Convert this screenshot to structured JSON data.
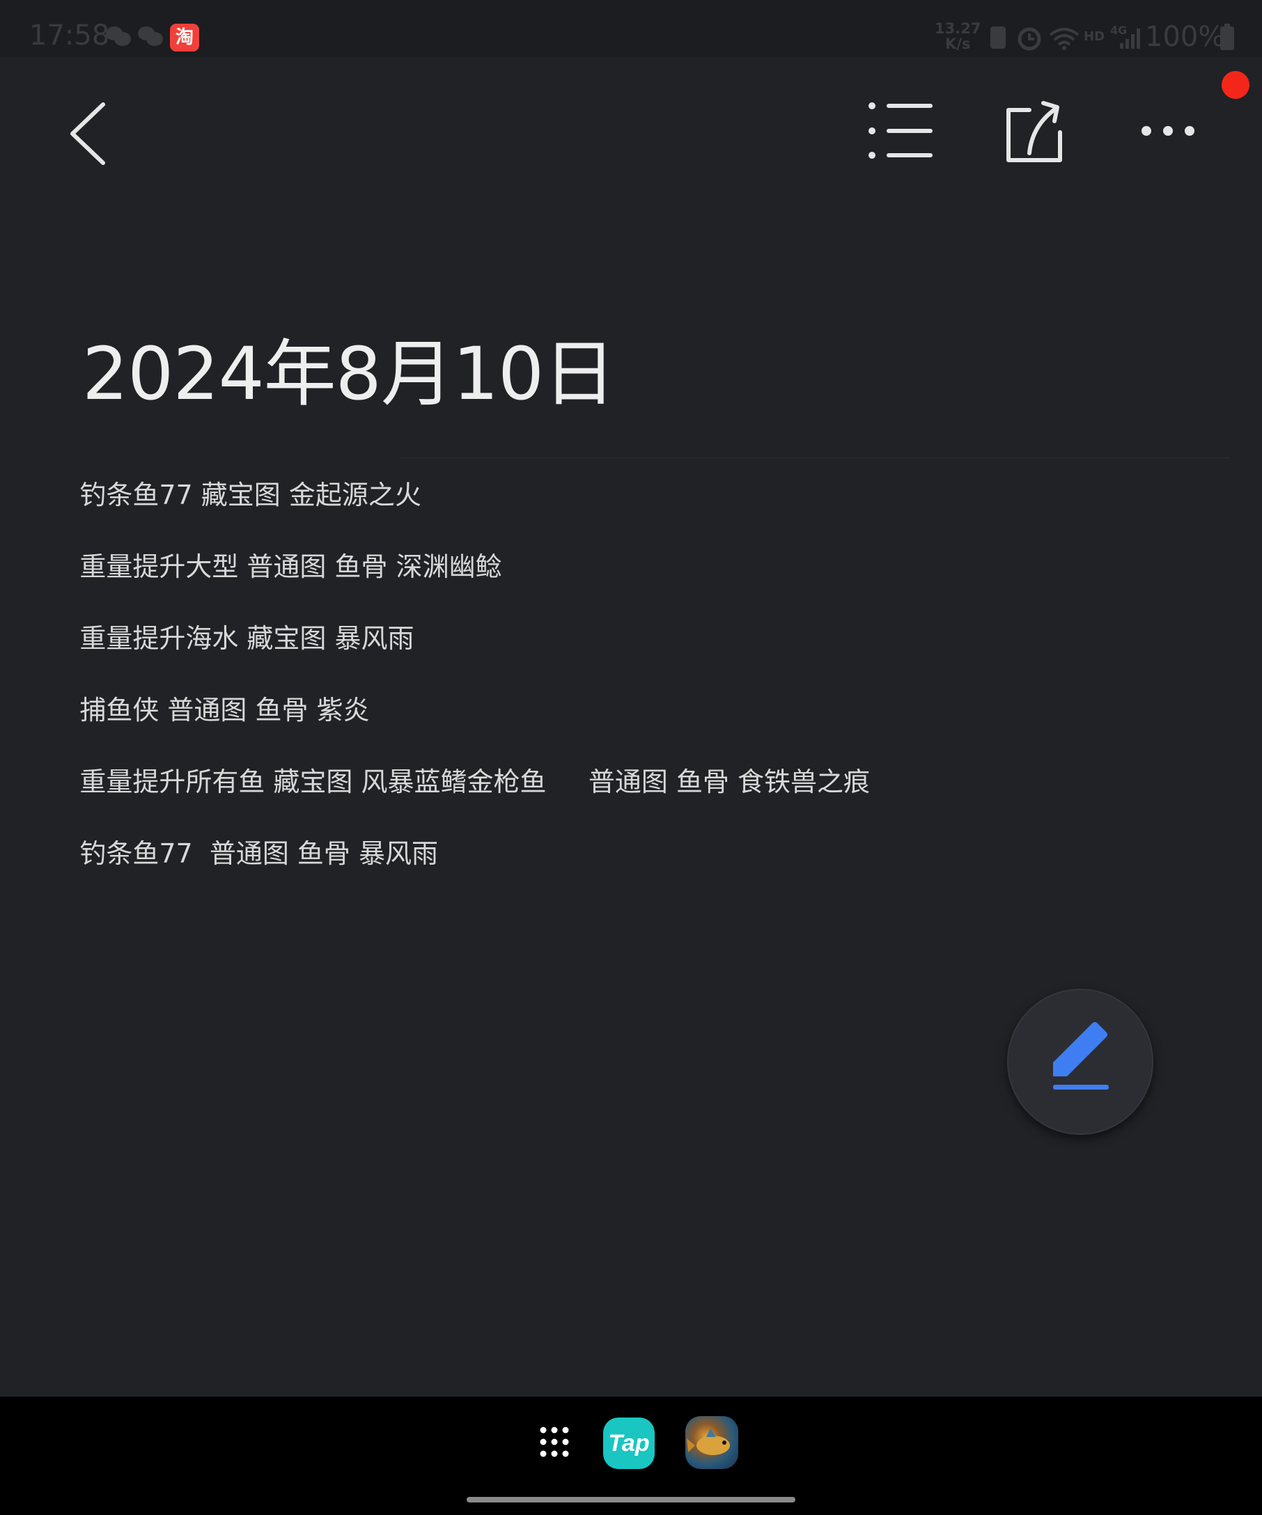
{
  "status_bar": {
    "time": "17:58",
    "speed_value": "13.27",
    "speed_unit": "K/s",
    "network_label": "HD",
    "cell_label": "4G",
    "battery": "100%",
    "notification_icons": [
      "wechat-icon",
      "wechat-icon",
      "taobao-icon"
    ],
    "taobao_glyph": "淘"
  },
  "toolbar": {
    "icons": [
      "back-arrow-icon",
      "list-icon",
      "share-icon",
      "more-icon"
    ]
  },
  "note": {
    "title": "2024年8月10日",
    "lines": [
      "钓条鱼77 藏宝图 金起源之火",
      "重量提升大型 普通图 鱼骨 深渊幽鲶",
      "重量提升海水 藏宝图 暴风雨",
      "捕鱼侠 普通图 鱼骨 紫炎",
      "重量提升所有鱼 藏宝图 风暴蓝鳍金枪鱼     普通图 鱼骨 食铁兽之痕",
      "钓条鱼77  普通图 鱼骨 暴风雨"
    ]
  },
  "fab": {
    "icon": "edit-pen-icon",
    "accent": "#3f7ef2"
  },
  "dock": {
    "apps": [
      "app-drawer-icon",
      "taptap-icon",
      "fishing-game-icon"
    ],
    "tap_label": "Tap"
  },
  "colors": {
    "background": "#202226",
    "notification_dot": "#f4261a",
    "tap_app": "#19c6c2"
  }
}
